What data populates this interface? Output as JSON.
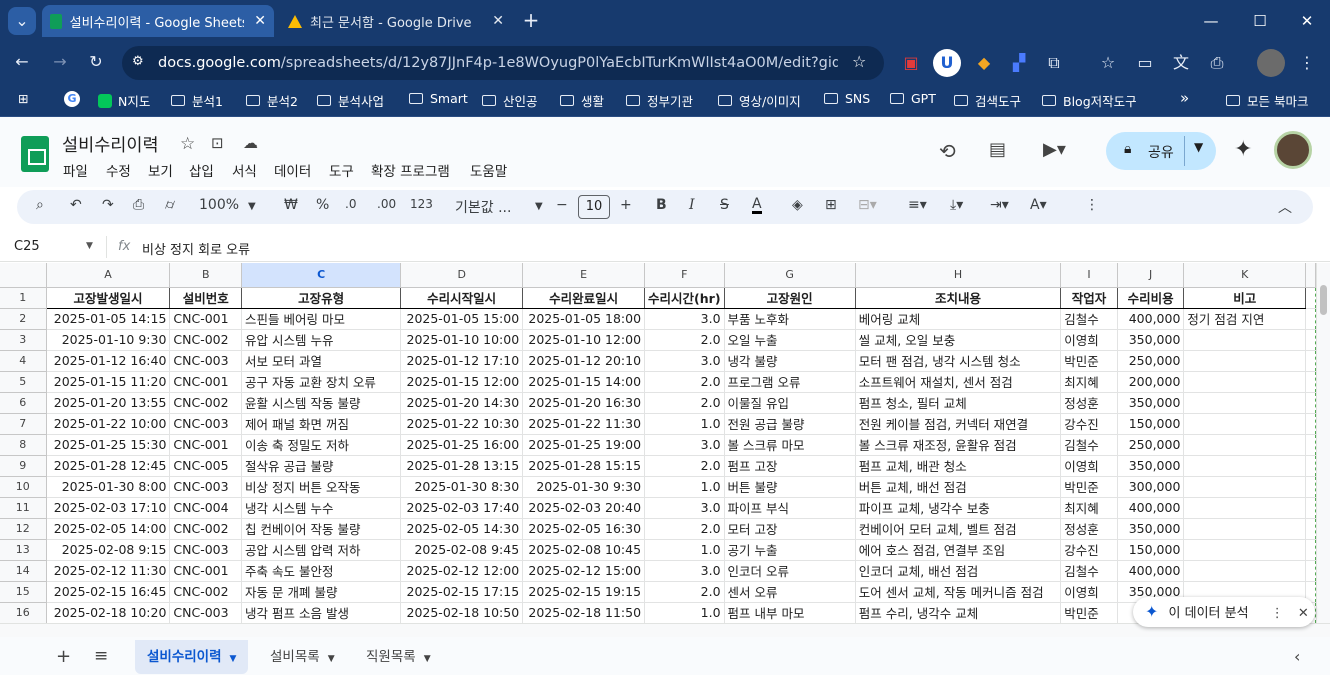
{
  "browser": {
    "tabs": [
      {
        "title": "설비수리이력 - Google Sheets",
        "close": "✕",
        "active": true
      },
      {
        "title": "최근 문서함 - Google Drive",
        "close": "✕",
        "active": false
      }
    ],
    "new_tab": "+",
    "url_host": "docs.google.com",
    "url_path": "/spreadsheets/d/12y87JJnF4p-1e8WOyugP0lYaEcbITurKmWlIst4aO0M/edit?gid=7095915...",
    "bookmarks": [
      "N지도",
      "분석1",
      "분석2",
      "분석사업",
      "Smart",
      "산인공",
      "생활",
      "정부기관",
      "영상/이미지",
      "SNS",
      "GPT",
      "검색도구",
      "Blog저작도구"
    ],
    "bookmarks_more": "»",
    "all_bookmarks": "모든 북마크"
  },
  "sheets": {
    "title": "설비수리이력",
    "menus": [
      "파일",
      "수정",
      "보기",
      "삽입",
      "서식",
      "데이터",
      "도구",
      "확장 프로그램",
      "도움말"
    ],
    "share_label": "공유",
    "toolbar": {
      "zoom": "100%",
      "currency": "₩",
      "percent": "%",
      "dec_less": ".0",
      "dec_more": ".00",
      "number_fmt": "123",
      "font": "기본값 ...",
      "minus": "−",
      "font_size": "10",
      "plus": "+",
      "bold": "B",
      "italic": "I",
      "strike": "S",
      "textcolor": "A"
    },
    "name_box": "C25",
    "formula_value": "비상 정지 회로 오류",
    "columns": [
      "A",
      "B",
      "C",
      "D",
      "E",
      "F",
      "G",
      "H",
      "I",
      "J",
      "K"
    ],
    "selected_column": "C",
    "headers": [
      "고장발생일시",
      "설비번호",
      "고장유형",
      "수리시작일시",
      "수리완료일시",
      "수리시간(hr)",
      "고장원인",
      "조치내용",
      "작업자",
      "수리비용",
      "비고"
    ],
    "rows": [
      [
        "2025-01-05 14:15",
        "CNC-001",
        "스핀들 베어링 마모",
        "2025-01-05 15:00",
        "2025-01-05 18:00",
        "3.0",
        "부품 노후화",
        "베어링 교체",
        "김철수",
        "400,000",
        "정기 점검 지연"
      ],
      [
        "2025-01-10 9:30",
        "CNC-002",
        "유압 시스템 누유",
        "2025-01-10 10:00",
        "2025-01-10 12:00",
        "2.0",
        "오일 누출",
        "씰 교체, 오일 보충",
        "이영희",
        "350,000",
        ""
      ],
      [
        "2025-01-12 16:40",
        "CNC-003",
        "서보 모터 과열",
        "2025-01-12 17:10",
        "2025-01-12 20:10",
        "3.0",
        "냉각 불량",
        "모터 팬 점검, 냉각 시스템 청소",
        "박민준",
        "250,000",
        ""
      ],
      [
        "2025-01-15 11:20",
        "CNC-001",
        "공구 자동 교환 장치 오류",
        "2025-01-15 12:00",
        "2025-01-15 14:00",
        "2.0",
        "프로그램 오류",
        "소프트웨어 재설치, 센서 점검",
        "최지혜",
        "200,000",
        ""
      ],
      [
        "2025-01-20 13:55",
        "CNC-002",
        "윤활 시스템 작동 불량",
        "2025-01-20 14:30",
        "2025-01-20 16:30",
        "2.0",
        "이물질 유입",
        "펌프 청소, 필터 교체",
        "정성훈",
        "350,000",
        ""
      ],
      [
        "2025-01-22 10:00",
        "CNC-003",
        "제어 패널 화면 꺼짐",
        "2025-01-22 10:30",
        "2025-01-22 11:30",
        "1.0",
        "전원 공급 불량",
        "전원 케이블 점검, 커넥터 재연결",
        "강수진",
        "150,000",
        ""
      ],
      [
        "2025-01-25 15:30",
        "CNC-001",
        "이송 축 정밀도 저하",
        "2025-01-25 16:00",
        "2025-01-25 19:00",
        "3.0",
        "볼 스크류 마모",
        "볼 스크류 재조정, 윤활유 점검",
        "김철수",
        "250,000",
        ""
      ],
      [
        "2025-01-28 12:45",
        "CNC-005",
        "절삭유 공급 불량",
        "2025-01-28 13:15",
        "2025-01-28 15:15",
        "2.0",
        "펌프 고장",
        "펌프 교체, 배관 청소",
        "이영희",
        "350,000",
        ""
      ],
      [
        "2025-01-30 8:00",
        "CNC-003",
        "비상 정지 버튼 오작동",
        "2025-01-30 8:30",
        "2025-01-30 9:30",
        "1.0",
        "버튼 불량",
        "버튼 교체, 배선 점검",
        "박민준",
        "300,000",
        ""
      ],
      [
        "2025-02-03 17:10",
        "CNC-004",
        "냉각 시스템 누수",
        "2025-02-03 17:40",
        "2025-02-03 20:40",
        "3.0",
        "파이프 부식",
        "파이프 교체, 냉각수 보충",
        "최지혜",
        "400,000",
        ""
      ],
      [
        "2025-02-05 14:00",
        "CNC-002",
        "칩 컨베이어 작동 불량",
        "2025-02-05 14:30",
        "2025-02-05 16:30",
        "2.0",
        "모터 고장",
        "컨베이어 모터 교체, 벨트 점검",
        "정성훈",
        "350,000",
        ""
      ],
      [
        "2025-02-08 9:15",
        "CNC-003",
        "공압 시스템 압력 저하",
        "2025-02-08 9:45",
        "2025-02-08 10:45",
        "1.0",
        "공기 누출",
        "에어 호스 점검, 연결부 조임",
        "강수진",
        "150,000",
        ""
      ],
      [
        "2025-02-12 11:30",
        "CNC-001",
        "주축 속도 불안정",
        "2025-02-12 12:00",
        "2025-02-12 15:00",
        "3.0",
        "인코더 오류",
        "인코더 교체, 배선 점검",
        "김철수",
        "400,000",
        ""
      ],
      [
        "2025-02-15 16:45",
        "CNC-002",
        "자동 문 개폐 불량",
        "2025-02-15 17:15",
        "2025-02-15 19:15",
        "2.0",
        "센서 오류",
        "도어 센서 교체, 작동 메커니즘 점검",
        "이영희",
        "350,000",
        ""
      ],
      [
        "2025-02-18 10:20",
        "CNC-003",
        "냉각 펌프 소음 발생",
        "2025-02-18 10:50",
        "2025-02-18 11:50",
        "1.0",
        "펌프 내부 마모",
        "펌프 수리, 냉각수 교체",
        "박민준",
        "",
        ""
      ]
    ],
    "sheet_tabs": [
      "설비수리이력",
      "설비목록",
      "직원목록"
    ],
    "explore_label": "이 데이터 분석"
  }
}
